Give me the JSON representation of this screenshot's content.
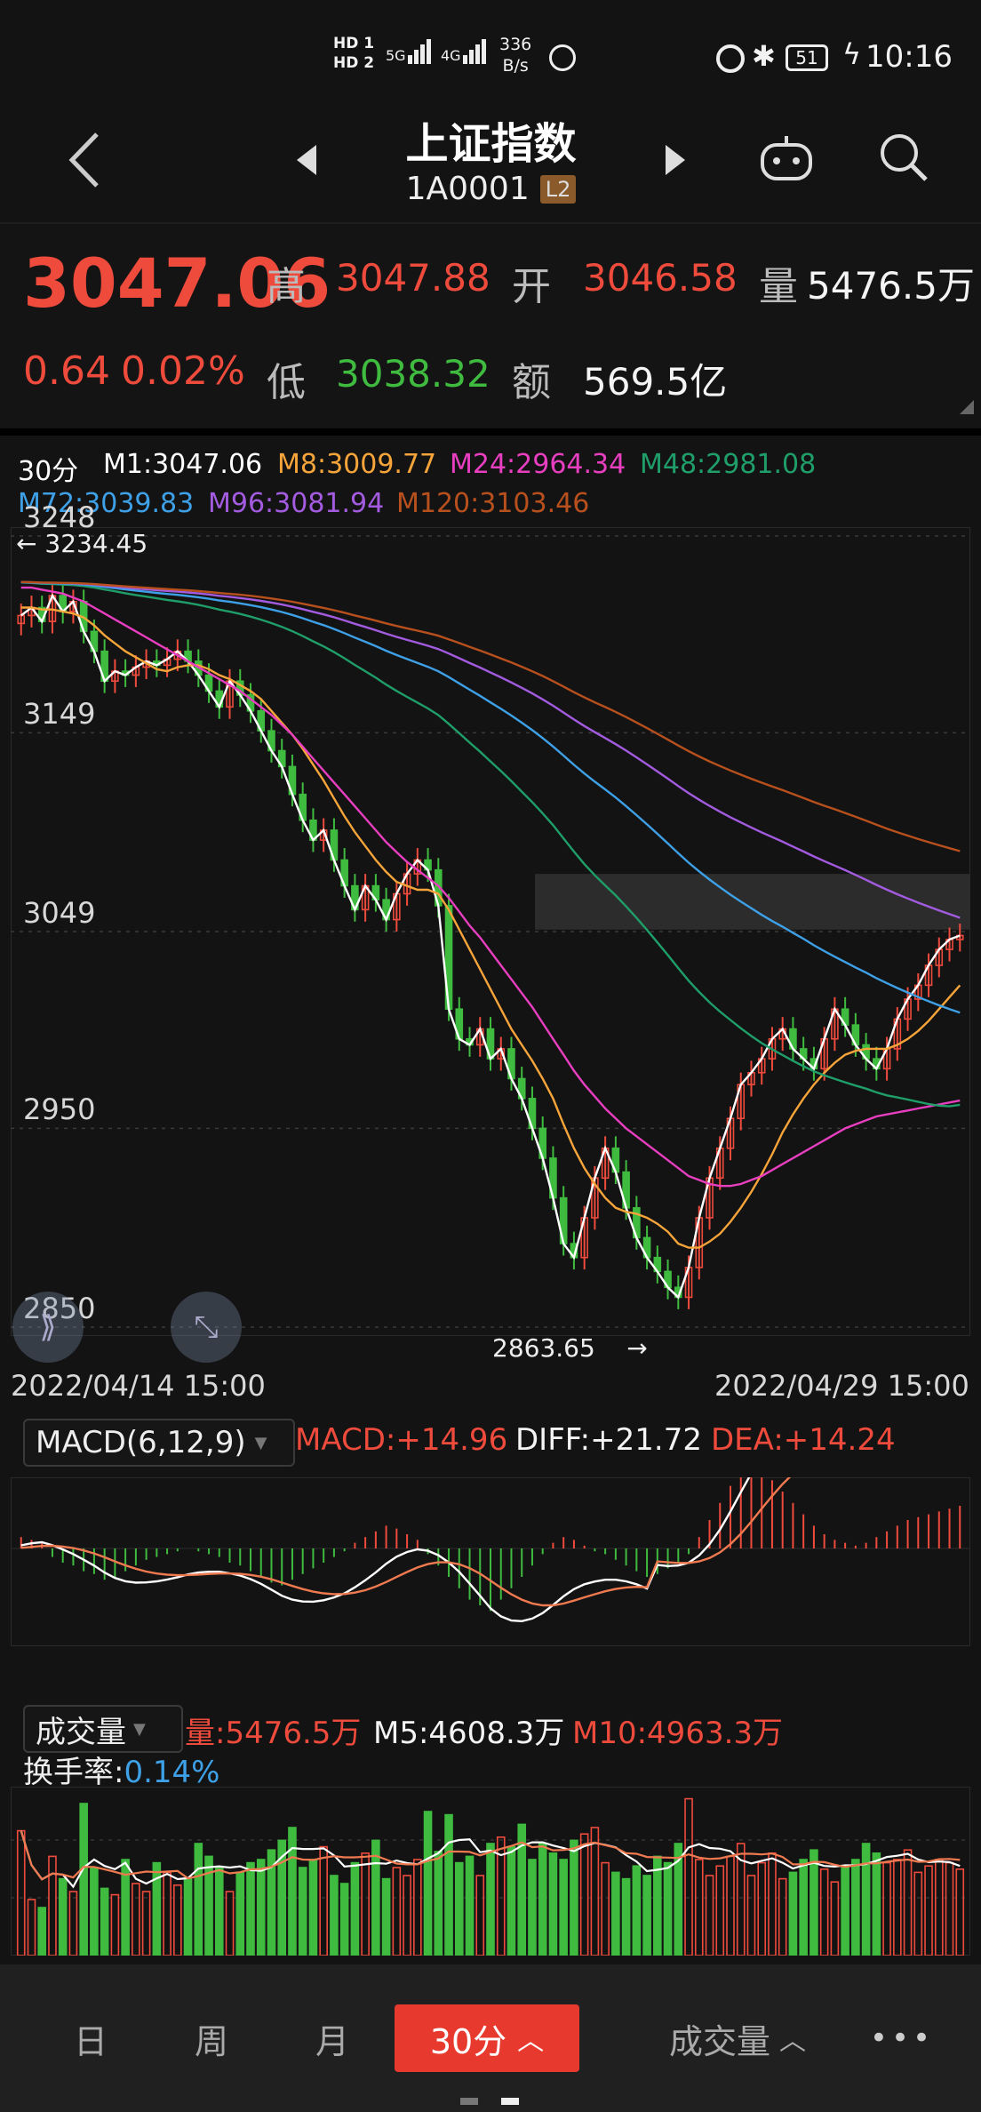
{
  "status_bar": {
    "network_top": "HD 1",
    "network_bottom": "HD 2",
    "signal_1": "5G",
    "signal_2": "4G",
    "speed_value": "336",
    "speed_unit": "B/s",
    "battery": "51",
    "time": "10:16"
  },
  "nav": {
    "title": "上证指数",
    "code": "1A0001",
    "badge": "L2"
  },
  "quote": {
    "price": "3047.06",
    "change": "0.64",
    "change_pct": "0.02%",
    "high_label": "高",
    "high": "3047.88",
    "open_label": "开",
    "open": "3046.58",
    "volume_label": "量",
    "volume": "5476.5万",
    "low_label": "低",
    "low": "3038.32",
    "amount_label": "额",
    "amount": "569.5亿"
  },
  "kline": {
    "period": "30分",
    "ma": [
      {
        "label": "M1:3047.06",
        "color": "#ffffff"
      },
      {
        "label": "M8:3009.77",
        "color": "#f7a53a"
      },
      {
        "label": "M24:2964.34",
        "color": "#e83ec0"
      },
      {
        "label": "M48:2981.08",
        "color": "#1f9e6a"
      },
      {
        "label": "M72:3039.83",
        "color": "#3ea0e6"
      },
      {
        "label": "M96:3081.94",
        "color": "#a35be0"
      },
      {
        "label": "M120:3103.46",
        "color": "#b8501e"
      }
    ],
    "high_label": "3234.45",
    "low_label": "2863.65",
    "y_ticks": [
      {
        "label": "3248",
        "value": 3248
      },
      {
        "label": "3149",
        "value": 3149
      },
      {
        "label": "3049",
        "value": 3049
      },
      {
        "label": "2950",
        "value": 2950
      },
      {
        "label": "2850",
        "value": 2850
      }
    ],
    "x_start": "2022/04/14 15:00",
    "x_end": "2022/04/29 15:00"
  },
  "macd": {
    "selector": "MACD(6,12,9)",
    "macd": "MACD:+14.96",
    "diff": "DIFF:+21.72",
    "dea": "DEA:+14.24"
  },
  "volume": {
    "selector": "成交量",
    "vol": "量:5476.5万",
    "m5": "M5:4608.3万",
    "m10": "M10:4963.3万",
    "turnover_label": "换手率:",
    "turnover": "0.14%"
  },
  "tabs": {
    "day": "日",
    "week": "周",
    "month": "月",
    "min30": "30分",
    "indicator": "成交量",
    "more": "•••"
  },
  "chart_data": {
    "type": "candlestick",
    "x_start": "2022/04/14 15:00",
    "x_end": "2022/04/29 15:00",
    "ylim": [
      2850,
      3248
    ],
    "high": 3234.45,
    "low": 2863.65,
    "close": [
      3208,
      3212,
      3205,
      3218,
      3210,
      3215,
      3200,
      3190,
      3175,
      3180,
      3178,
      3182,
      3185,
      3183,
      3186,
      3190,
      3185,
      3178,
      3170,
      3162,
      3175,
      3168,
      3160,
      3150,
      3140,
      3132,
      3118,
      3105,
      3095,
      3100,
      3085,
      3072,
      3060,
      3072,
      3065,
      3055,
      3068,
      3078,
      3085,
      3080,
      3062,
      3010,
      2995,
      2992,
      3000,
      2985,
      2990,
      2975,
      2965,
      2950,
      2935,
      2915,
      2892,
      2885,
      2905,
      2925,
      2940,
      2928,
      2910,
      2895,
      2885,
      2878,
      2870,
      2865,
      2880,
      2905,
      2925,
      2940,
      2955,
      2972,
      2978,
      2985,
      2995,
      3000,
      2990,
      2985,
      2980,
      2995,
      3010,
      3002,
      2992,
      2985,
      2980,
      2990,
      3005,
      3015,
      3022,
      3032,
      3040,
      3045,
      3047
    ],
    "ma8": [
      3212,
      3212,
      3211,
      3211,
      3210,
      3209,
      3207,
      3203,
      3198,
      3194,
      3190,
      3187,
      3184,
      3181,
      3180,
      3182,
      3183,
      3183,
      3181,
      3178,
      3176,
      3173,
      3170,
      3166,
      3160,
      3154,
      3148,
      3141,
      3133,
      3125,
      3116,
      3107,
      3099,
      3092,
      3085,
      3079,
      3074,
      3072,
      3070,
      3070,
      3068,
      3060,
      3050,
      3040,
      3030,
      3020,
      3010,
      3000,
      2992,
      2984,
      2975,
      2965,
      2952,
      2940,
      2930,
      2922,
      2915,
      2910,
      2908,
      2907,
      2905,
      2902,
      2898,
      2892,
      2890,
      2890,
      2893,
      2897,
      2903,
      2910,
      2918,
      2927,
      2937,
      2948,
      2957,
      2965,
      2972,
      2978,
      2983,
      2987,
      2989,
      2990,
      2990,
      2990,
      2992,
      2995,
      2999,
      3004,
      3010,
      3016,
      3022
    ],
    "ma24": [
      3222,
      3222,
      3221,
      3220,
      3219,
      3217,
      3215,
      3212,
      3209,
      3206,
      3203,
      3200,
      3197,
      3194,
      3191,
      3188,
      3185,
      3182,
      3179,
      3176,
      3173,
      3170,
      3166,
      3162,
      3158,
      3153,
      3148,
      3142,
      3136,
      3130,
      3124,
      3118,
      3112,
      3106,
      3100,
      3094,
      3089,
      3084,
      3080,
      3076,
      3072,
      3066,
      3059,
      3052,
      3046,
      3039,
      3032,
      3025,
      3018,
      3011,
      3003,
      2995,
      2987,
      2979,
      2972,
      2966,
      2960,
      2955,
      2950,
      2946,
      2942,
      2938,
      2934,
      2930,
      2926,
      2924,
      2922,
      2921,
      2921,
      2922,
      2924,
      2926,
      2929,
      2932,
      2935,
      2938,
      2941,
      2944,
      2947,
      2950,
      2952,
      2954,
      2956,
      2957,
      2958,
      2959,
      2960,
      2961,
      2962,
      2963,
      2964
    ],
    "macd_hist": [
      4,
      3,
      2,
      -3,
      -5,
      -6,
      -8,
      -9,
      -11,
      -10,
      -8,
      -6,
      -4,
      -3,
      -2,
      -1,
      0,
      -1,
      -2,
      -3,
      -5,
      -6,
      -8,
      -10,
      -12,
      -13,
      -11,
      -9,
      -7,
      -5,
      -3,
      -1,
      2,
      4,
      6,
      8,
      7,
      5,
      3,
      -2,
      -6,
      -10,
      -14,
      -18,
      -20,
      -22,
      -18,
      -14,
      -10,
      -6,
      -2,
      2,
      4,
      3,
      1,
      -1,
      -2,
      -4,
      -6,
      -8,
      -10,
      -9,
      -7,
      -5,
      -2,
      4,
      10,
      16,
      22,
      26,
      28,
      27,
      24,
      20,
      16,
      12,
      8,
      5,
      3,
      2,
      1,
      2,
      4,
      6,
      8,
      10,
      11,
      12,
      13,
      14,
      15
    ],
    "volume": [
      78,
      35,
      30,
      62,
      48,
      40,
      95,
      55,
      42,
      38,
      60,
      45,
      40,
      58,
      52,
      44,
      48,
      70,
      62,
      55,
      40,
      52,
      58,
      60,
      66,
      72,
      80,
      55,
      60,
      68,
      50,
      45,
      58,
      64,
      72,
      48,
      55,
      50,
      60,
      90,
      65,
      88,
      58,
      62,
      50,
      70,
      74,
      68,
      82,
      60,
      70,
      64,
      60,
      72,
      76,
      80,
      58,
      52,
      48,
      56,
      50,
      62,
      58,
      70,
      98,
      60,
      50,
      56,
      62,
      70,
      50,
      58,
      64,
      48,
      52,
      60,
      66,
      54,
      46,
      56,
      60,
      70,
      64,
      58,
      60,
      66,
      52,
      56,
      60,
      58,
      54
    ]
  }
}
